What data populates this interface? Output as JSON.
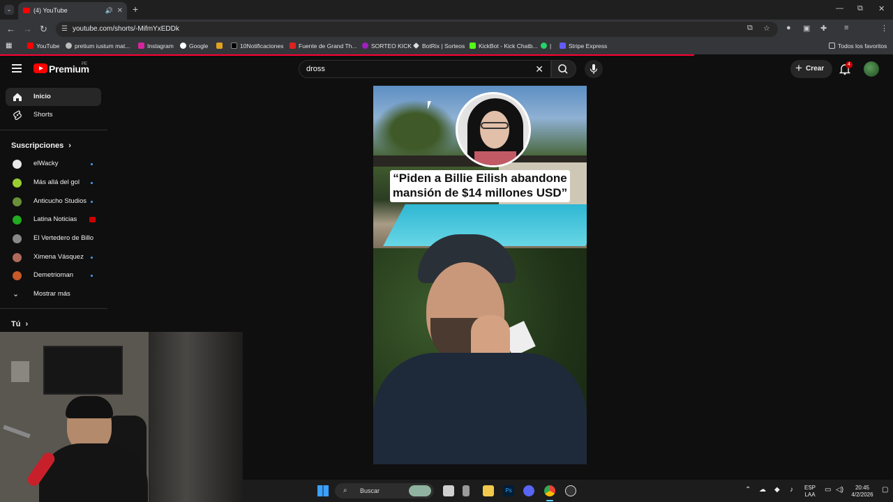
{
  "browser": {
    "tab_title": "(4) YouTube",
    "url": "youtube.com/shorts/-MifmYxEDDk",
    "bookmarks": [
      "YouTube",
      "pretium iustum mat...",
      "Instagram",
      "Google",
      "10Notificaciones",
      "Fuente de Grand Th...",
      "SORTEO KICK",
      "BotRix | Sorteos",
      "KickBot - Kick Chatb...",
      "|",
      "Stripe Express"
    ],
    "all_bookmarks": "Todos los favoritos"
  },
  "header": {
    "logo_text": "Premium",
    "country": "PE",
    "search_value": "dross",
    "create_label": "Crear",
    "notification_count": "4"
  },
  "sidebar": {
    "home": "Inicio",
    "shorts": "Shorts",
    "subscriptions_title": "Suscripciones",
    "subscriptions": [
      {
        "name": "elWacky",
        "color": "#e8e8e8"
      },
      {
        "name": "Más allá del gol",
        "color": "#9acd32"
      },
      {
        "name": "Anticucho Studios",
        "color": "#6b8f3a"
      },
      {
        "name": "Latina Noticias",
        "color": "#22aa22"
      },
      {
        "name": "El Vertedero de Billo",
        "color": "#888888"
      },
      {
        "name": "Ximena Vásquez",
        "color": "#b06a5a"
      },
      {
        "name": "Demetrioman",
        "color": "#c85a2a"
      }
    ],
    "show_more": "Mostrar más",
    "you_title": "Tú"
  },
  "short": {
    "caption_line1": "“Piden a Billie Eilish abandone",
    "caption_line2": "mansión de $14 millones USD”"
  },
  "taskbar": {
    "search_label": "Buscar",
    "lang1": "ESP",
    "lang2": "LAA",
    "time": "20:45",
    "date": "4/2/2026"
  }
}
